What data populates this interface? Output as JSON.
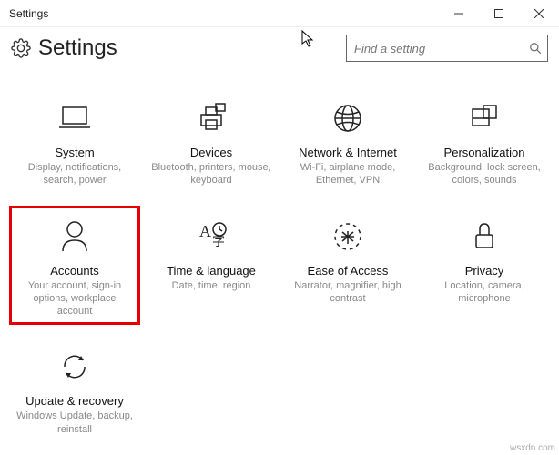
{
  "window": {
    "title": "Settings"
  },
  "header": {
    "title": "Settings",
    "search_placeholder": "Find a setting"
  },
  "tiles": [
    {
      "title": "System",
      "desc": "Display, notifications, search, power"
    },
    {
      "title": "Devices",
      "desc": "Bluetooth, printers, mouse, keyboard"
    },
    {
      "title": "Network & Internet",
      "desc": "Wi-Fi, airplane mode, Ethernet, VPN"
    },
    {
      "title": "Personalization",
      "desc": "Background, lock screen, colors, sounds"
    },
    {
      "title": "Accounts",
      "desc": "Your account, sign-in options, workplace account"
    },
    {
      "title": "Time & language",
      "desc": "Date, time, region"
    },
    {
      "title": "Ease of Access",
      "desc": "Narrator, magnifier, high contrast"
    },
    {
      "title": "Privacy",
      "desc": "Location, camera, microphone"
    },
    {
      "title": "Update & recovery",
      "desc": "Windows Update, backup, reinstall"
    }
  ],
  "watermark": "wsxdn.com"
}
